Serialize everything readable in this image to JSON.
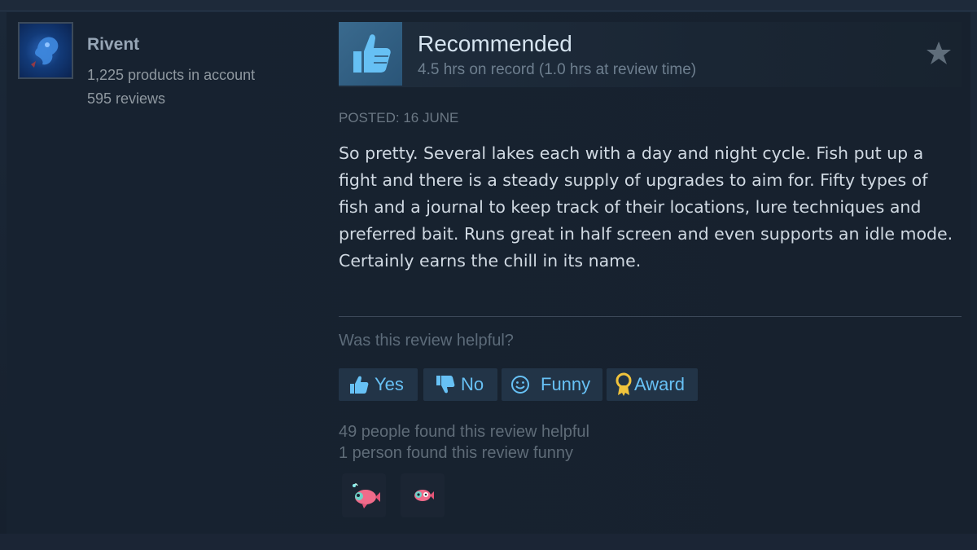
{
  "author": {
    "name": "Rivent",
    "products": "1,225 products in account",
    "reviews": "595 reviews"
  },
  "review": {
    "verdict": "Recommended",
    "hours": "4.5 hrs on record (1.0 hrs at review time)",
    "posted": "POSTED: 16 JUNE",
    "text": "So pretty. Several lakes each with a day and night cycle. Fish put up a fight and there is a steady supply of upgrades to aim for. Fifty types of fish and a journal to keep track of their locations, lure techniques and preferred bait. Runs great in half screen and even supports an idle mode. Certainly earns the chill in its name."
  },
  "feedback": {
    "question": "Was this review helpful?",
    "buttons": {
      "yes": "Yes",
      "no": "No",
      "funny": "Funny",
      "award": "Award"
    },
    "helpful_count": "49 people found this review helpful",
    "funny_count": "1 person found this review funny"
  },
  "icons": {
    "verdict": "thumbs-up-icon",
    "favorite": "star-icon",
    "yes": "thumbs-up-icon",
    "no": "thumbs-down-icon",
    "funny": "smiley-icon",
    "award": "award-ribbon-icon",
    "awards_received": [
      "fish-award-icon",
      "fish-award-icon"
    ]
  },
  "colors": {
    "accent": "#67c1f5",
    "background": "#16202d",
    "award_pink": "#f06b8a"
  }
}
